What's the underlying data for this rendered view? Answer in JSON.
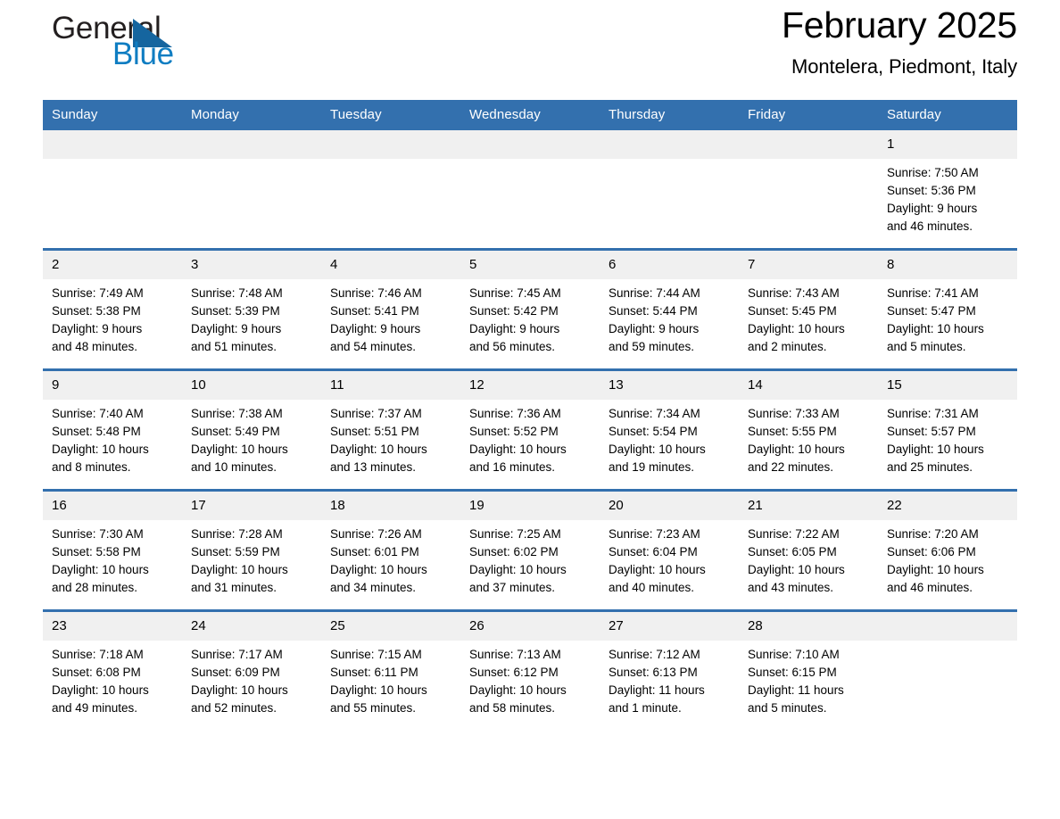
{
  "brand": {
    "name_part1": "General",
    "name_part2": "Blue",
    "triangle_color": "#15659f",
    "blue_color": "#0f7dc2"
  },
  "header": {
    "title": "February 2025",
    "subtitle": "Montelera, Piedmont, Italy"
  },
  "theme": {
    "header_blue": "#3370ae",
    "daynum_bg": "#f0f0f0"
  },
  "calendar": {
    "weekday_headers": [
      "Sunday",
      "Monday",
      "Tuesday",
      "Wednesday",
      "Thursday",
      "Friday",
      "Saturday"
    ],
    "weeks": [
      [
        {
          "day": "",
          "sunrise": "",
          "sunset": "",
          "daylight_line1": "",
          "daylight_line2": ""
        },
        {
          "day": "",
          "sunrise": "",
          "sunset": "",
          "daylight_line1": "",
          "daylight_line2": ""
        },
        {
          "day": "",
          "sunrise": "",
          "sunset": "",
          "daylight_line1": "",
          "daylight_line2": ""
        },
        {
          "day": "",
          "sunrise": "",
          "sunset": "",
          "daylight_line1": "",
          "daylight_line2": ""
        },
        {
          "day": "",
          "sunrise": "",
          "sunset": "",
          "daylight_line1": "",
          "daylight_line2": ""
        },
        {
          "day": "",
          "sunrise": "",
          "sunset": "",
          "daylight_line1": "",
          "daylight_line2": ""
        },
        {
          "day": "1",
          "sunrise": "Sunrise: 7:50 AM",
          "sunset": "Sunset: 5:36 PM",
          "daylight_line1": "Daylight: 9 hours",
          "daylight_line2": "and 46 minutes."
        }
      ],
      [
        {
          "day": "2",
          "sunrise": "Sunrise: 7:49 AM",
          "sunset": "Sunset: 5:38 PM",
          "daylight_line1": "Daylight: 9 hours",
          "daylight_line2": "and 48 minutes."
        },
        {
          "day": "3",
          "sunrise": "Sunrise: 7:48 AM",
          "sunset": "Sunset: 5:39 PM",
          "daylight_line1": "Daylight: 9 hours",
          "daylight_line2": "and 51 minutes."
        },
        {
          "day": "4",
          "sunrise": "Sunrise: 7:46 AM",
          "sunset": "Sunset: 5:41 PM",
          "daylight_line1": "Daylight: 9 hours",
          "daylight_line2": "and 54 minutes."
        },
        {
          "day": "5",
          "sunrise": "Sunrise: 7:45 AM",
          "sunset": "Sunset: 5:42 PM",
          "daylight_line1": "Daylight: 9 hours",
          "daylight_line2": "and 56 minutes."
        },
        {
          "day": "6",
          "sunrise": "Sunrise: 7:44 AM",
          "sunset": "Sunset: 5:44 PM",
          "daylight_line1": "Daylight: 9 hours",
          "daylight_line2": "and 59 minutes."
        },
        {
          "day": "7",
          "sunrise": "Sunrise: 7:43 AM",
          "sunset": "Sunset: 5:45 PM",
          "daylight_line1": "Daylight: 10 hours",
          "daylight_line2": "and 2 minutes."
        },
        {
          "day": "8",
          "sunrise": "Sunrise: 7:41 AM",
          "sunset": "Sunset: 5:47 PM",
          "daylight_line1": "Daylight: 10 hours",
          "daylight_line2": "and 5 minutes."
        }
      ],
      [
        {
          "day": "9",
          "sunrise": "Sunrise: 7:40 AM",
          "sunset": "Sunset: 5:48 PM",
          "daylight_line1": "Daylight: 10 hours",
          "daylight_line2": "and 8 minutes."
        },
        {
          "day": "10",
          "sunrise": "Sunrise: 7:38 AM",
          "sunset": "Sunset: 5:49 PM",
          "daylight_line1": "Daylight: 10 hours",
          "daylight_line2": "and 10 minutes."
        },
        {
          "day": "11",
          "sunrise": "Sunrise: 7:37 AM",
          "sunset": "Sunset: 5:51 PM",
          "daylight_line1": "Daylight: 10 hours",
          "daylight_line2": "and 13 minutes."
        },
        {
          "day": "12",
          "sunrise": "Sunrise: 7:36 AM",
          "sunset": "Sunset: 5:52 PM",
          "daylight_line1": "Daylight: 10 hours",
          "daylight_line2": "and 16 minutes."
        },
        {
          "day": "13",
          "sunrise": "Sunrise: 7:34 AM",
          "sunset": "Sunset: 5:54 PM",
          "daylight_line1": "Daylight: 10 hours",
          "daylight_line2": "and 19 minutes."
        },
        {
          "day": "14",
          "sunrise": "Sunrise: 7:33 AM",
          "sunset": "Sunset: 5:55 PM",
          "daylight_line1": "Daylight: 10 hours",
          "daylight_line2": "and 22 minutes."
        },
        {
          "day": "15",
          "sunrise": "Sunrise: 7:31 AM",
          "sunset": "Sunset: 5:57 PM",
          "daylight_line1": "Daylight: 10 hours",
          "daylight_line2": "and 25 minutes."
        }
      ],
      [
        {
          "day": "16",
          "sunrise": "Sunrise: 7:30 AM",
          "sunset": "Sunset: 5:58 PM",
          "daylight_line1": "Daylight: 10 hours",
          "daylight_line2": "and 28 minutes."
        },
        {
          "day": "17",
          "sunrise": "Sunrise: 7:28 AM",
          "sunset": "Sunset: 5:59 PM",
          "daylight_line1": "Daylight: 10 hours",
          "daylight_line2": "and 31 minutes."
        },
        {
          "day": "18",
          "sunrise": "Sunrise: 7:26 AM",
          "sunset": "Sunset: 6:01 PM",
          "daylight_line1": "Daylight: 10 hours",
          "daylight_line2": "and 34 minutes."
        },
        {
          "day": "19",
          "sunrise": "Sunrise: 7:25 AM",
          "sunset": "Sunset: 6:02 PM",
          "daylight_line1": "Daylight: 10 hours",
          "daylight_line2": "and 37 minutes."
        },
        {
          "day": "20",
          "sunrise": "Sunrise: 7:23 AM",
          "sunset": "Sunset: 6:04 PM",
          "daylight_line1": "Daylight: 10 hours",
          "daylight_line2": "and 40 minutes."
        },
        {
          "day": "21",
          "sunrise": "Sunrise: 7:22 AM",
          "sunset": "Sunset: 6:05 PM",
          "daylight_line1": "Daylight: 10 hours",
          "daylight_line2": "and 43 minutes."
        },
        {
          "day": "22",
          "sunrise": "Sunrise: 7:20 AM",
          "sunset": "Sunset: 6:06 PM",
          "daylight_line1": "Daylight: 10 hours",
          "daylight_line2": "and 46 minutes."
        }
      ],
      [
        {
          "day": "23",
          "sunrise": "Sunrise: 7:18 AM",
          "sunset": "Sunset: 6:08 PM",
          "daylight_line1": "Daylight: 10 hours",
          "daylight_line2": "and 49 minutes."
        },
        {
          "day": "24",
          "sunrise": "Sunrise: 7:17 AM",
          "sunset": "Sunset: 6:09 PM",
          "daylight_line1": "Daylight: 10 hours",
          "daylight_line2": "and 52 minutes."
        },
        {
          "day": "25",
          "sunrise": "Sunrise: 7:15 AM",
          "sunset": "Sunset: 6:11 PM",
          "daylight_line1": "Daylight: 10 hours",
          "daylight_line2": "and 55 minutes."
        },
        {
          "day": "26",
          "sunrise": "Sunrise: 7:13 AM",
          "sunset": "Sunset: 6:12 PM",
          "daylight_line1": "Daylight: 10 hours",
          "daylight_line2": "and 58 minutes."
        },
        {
          "day": "27",
          "sunrise": "Sunrise: 7:12 AM",
          "sunset": "Sunset: 6:13 PM",
          "daylight_line1": "Daylight: 11 hours",
          "daylight_line2": "and 1 minute."
        },
        {
          "day": "28",
          "sunrise": "Sunrise: 7:10 AM",
          "sunset": "Sunset: 6:15 PM",
          "daylight_line1": "Daylight: 11 hours",
          "daylight_line2": "and 5 minutes."
        },
        {
          "day": "",
          "sunrise": "",
          "sunset": "",
          "daylight_line1": "",
          "daylight_line2": ""
        }
      ]
    ]
  }
}
